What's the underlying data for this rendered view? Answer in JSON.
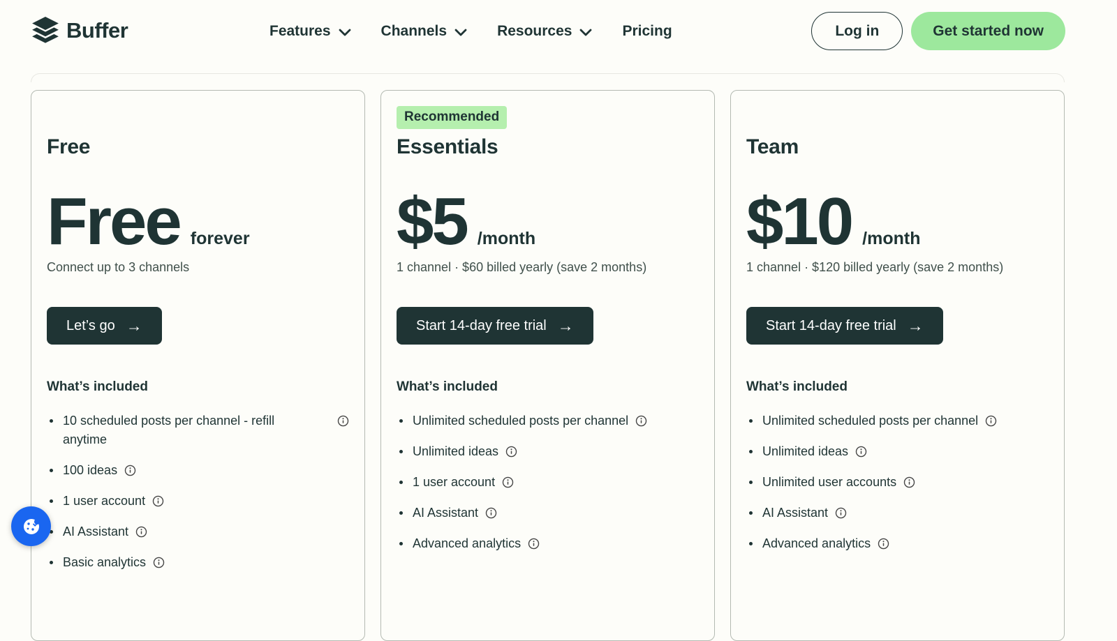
{
  "brand": {
    "name": "Buffer"
  },
  "nav": {
    "items": [
      {
        "label": "Features",
        "has_dropdown": true
      },
      {
        "label": "Channels",
        "has_dropdown": true
      },
      {
        "label": "Resources",
        "has_dropdown": true
      },
      {
        "label": "Pricing",
        "has_dropdown": false
      }
    ],
    "login_label": "Log in",
    "cta_label": "Get started now"
  },
  "icons": {
    "arrow_right": "→"
  },
  "plans": [
    {
      "name": "Free",
      "badge": "",
      "price": "Free",
      "price_suffix": "forever",
      "billing_note": "Connect up to 3 channels",
      "cta": "Let’s go",
      "included_title": "What’s included",
      "features": [
        "10 scheduled posts per channel - refill anytime",
        "100 ideas",
        "1 user account",
        "AI Assistant",
        "Basic analytics"
      ]
    },
    {
      "name": "Essentials",
      "badge": "Recommended",
      "price": "$5",
      "price_suffix": "/month",
      "billing_note": "1 channel · $60 billed yearly (save 2 months)",
      "cta": "Start 14-day free trial",
      "included_title": "What’s included",
      "features": [
        "Unlimited scheduled posts per channel",
        "Unlimited ideas",
        "1 user account",
        "AI Assistant",
        "Advanced analytics"
      ]
    },
    {
      "name": "Team",
      "badge": "",
      "price": "$10",
      "price_suffix": "/month",
      "billing_note": "1 channel · $120 billed yearly (save 2 months)",
      "cta": "Start 14-day free trial",
      "included_title": "What’s included",
      "features": [
        "Unlimited scheduled posts per channel",
        "Unlimited ideas",
        "Unlimited user accounts",
        "AI Assistant",
        "Advanced analytics"
      ]
    }
  ],
  "colors": {
    "accent_green": "#9de89d",
    "badge_green": "#b5efae",
    "button_dark": "#1f3434",
    "cookie_widget_blue": "#1a66f0"
  }
}
